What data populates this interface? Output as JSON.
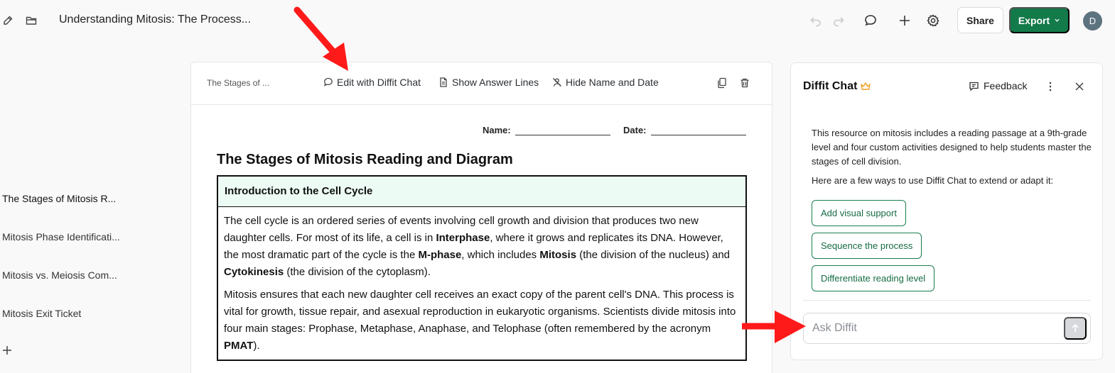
{
  "topbar": {
    "doc_title": "Understanding Mitosis: The Process...",
    "share_label": "Share",
    "export_label": "Export",
    "avatar_initial": "D",
    "icons": [
      "edit-icon",
      "folder-icon",
      "undo-icon",
      "redo-icon",
      "chat-bubble-icon",
      "plus-icon",
      "gear-icon",
      "chevron-down-icon"
    ]
  },
  "outline": {
    "items": [
      "The Stages of Mitosis R...",
      "Mitosis Phase Identificati...",
      "Mitosis vs. Meiosis Com...",
      "Mitosis Exit Ticket"
    ]
  },
  "doc": {
    "crumb": "The Stages of ...",
    "toolbar": {
      "edit_chat": "Edit with Diffit Chat",
      "answer_lines": "Show Answer Lines",
      "hide_name_date": "Hide Name and Date"
    },
    "name_label": "Name:",
    "date_label": "Date:",
    "sheet_title": "The Stages of Mitosis Reading and Diagram",
    "passage": {
      "heading": "Introduction to the Cell Cycle",
      "p1_a": "The cell cycle is an ordered series of events involving cell growth and division that produces two new daughter cells. For most of its life, a cell is in ",
      "p1_b1": "Interphase",
      "p1_c": ", where it grows and replicates its DNA. However, the most dramatic part of the cycle is the ",
      "p1_b2": "M-phase",
      "p1_d": ", which includes ",
      "p1_b3": "Mitosis",
      "p1_e": " (the division of the nucleus) and ",
      "p1_b4": "Cytokinesis",
      "p1_f": " (the division of the cytoplasm).",
      "p2_a": "Mitosis ensures that each new daughter cell receives an exact copy of the parent cell's DNA. This process is vital for growth, tissue repair, and asexual reproduction in eukaryotic organisms. Scientists divide mitosis into four main stages: Prophase, Metaphase, Anaphase, and Telophase (often remembered by the acronym ",
      "p2_b": "PMAT",
      "p2_c": ")."
    }
  },
  "chat": {
    "title": "Diffit Chat",
    "feedback_label": "Feedback",
    "intro": "This resource on mitosis includes a reading passage at a 9th-grade level and four custom activities designed to help students master the stages of cell division.",
    "ways": "Here are a few ways to use Diffit Chat to extend or adapt it:",
    "suggestions": [
      "Add visual support",
      "Sequence the process",
      "Differentiate reading level"
    ],
    "input_placeholder": "Ask Diffit",
    "input_value": ""
  },
  "colors": {
    "brand_green": "#137a4a",
    "passage_header_bg": "#ecfbf4",
    "annotation_arrow": "#ff1a1a",
    "crown": "#f0a020"
  }
}
